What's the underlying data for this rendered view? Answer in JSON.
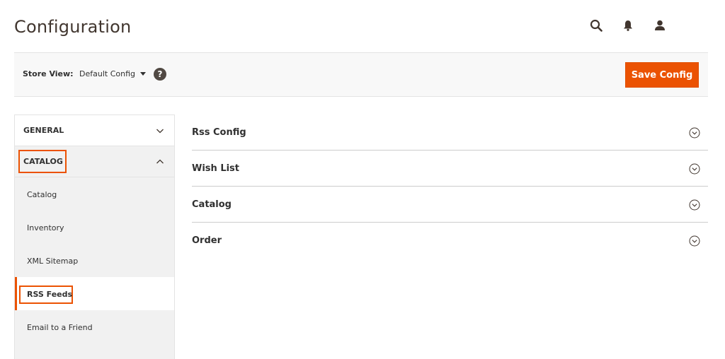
{
  "page": {
    "title": "Configuration"
  },
  "header": {
    "icons": [
      "search-icon",
      "notifications-bell-icon",
      "user-account-icon"
    ]
  },
  "toolbar": {
    "store_view_label": "Store View:",
    "store_view_value": "Default Config",
    "help_label": "?",
    "save_label": "Save Config"
  },
  "sidebar": {
    "sections": [
      {
        "label": "GENERAL",
        "expanded": false
      },
      {
        "label": "CATALOG",
        "expanded": true
      }
    ],
    "items": [
      {
        "label": "Catalog"
      },
      {
        "label": "Inventory"
      },
      {
        "label": "XML Sitemap"
      },
      {
        "label": "RSS Feeds",
        "active": true
      },
      {
        "label": "Email to a Friend"
      }
    ]
  },
  "main": {
    "sections": [
      {
        "title": "Rss Config"
      },
      {
        "title": "Wish List"
      },
      {
        "title": "Catalog"
      },
      {
        "title": "Order"
      }
    ]
  },
  "colors": {
    "accent": "#eb5202",
    "text": "#303030",
    "panel": "#f8f8f8"
  }
}
